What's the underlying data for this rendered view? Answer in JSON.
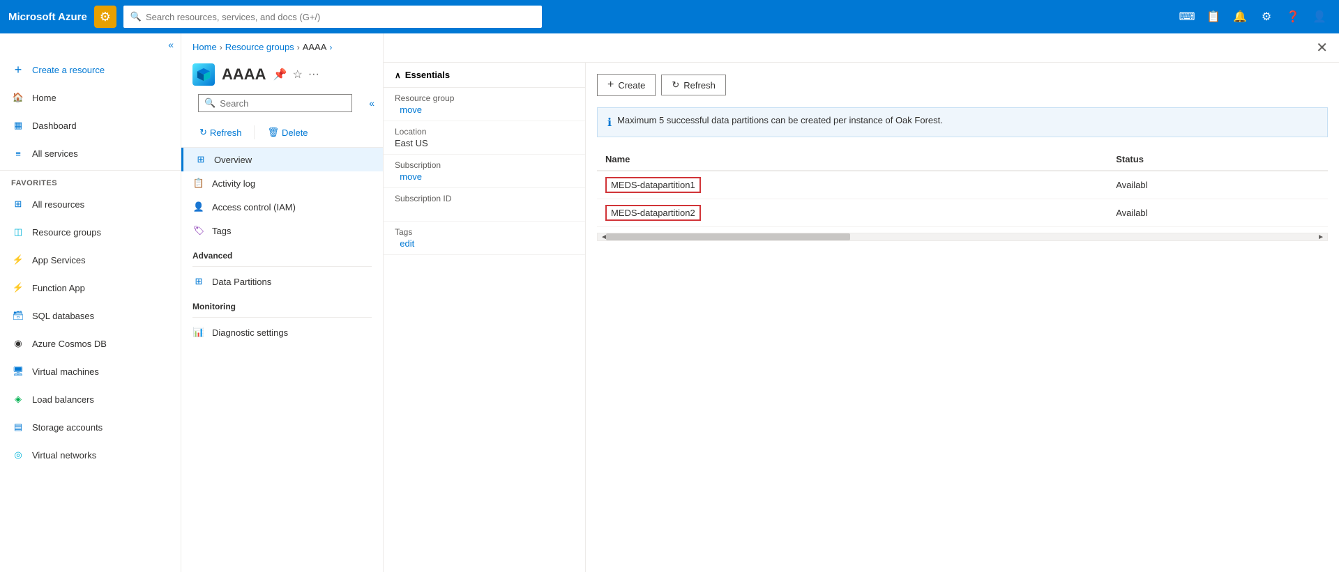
{
  "topbar": {
    "logo": "Microsoft Azure",
    "search_placeholder": "Search resources, services, and docs (G+/)",
    "shortcut": "G+/"
  },
  "sidebar": {
    "collapse_tooltip": "Collapse",
    "items": [
      {
        "id": "create-resource",
        "label": "Create a resource",
        "icon": "plus"
      },
      {
        "id": "home",
        "label": "Home",
        "icon": "home"
      },
      {
        "id": "dashboard",
        "label": "Dashboard",
        "icon": "dashboard"
      },
      {
        "id": "all-services",
        "label": "All services",
        "icon": "all-services"
      }
    ],
    "favorites_label": "FAVORITES",
    "favorites": [
      {
        "id": "all-resources",
        "label": "All resources",
        "icon": "grid"
      },
      {
        "id": "resource-groups",
        "label": "Resource groups",
        "icon": "resource-groups"
      },
      {
        "id": "app-services",
        "label": "App Services",
        "icon": "app-services"
      },
      {
        "id": "function-app",
        "label": "Function App",
        "icon": "function-app"
      },
      {
        "id": "sql-databases",
        "label": "SQL databases",
        "icon": "sql"
      },
      {
        "id": "azure-cosmos-db",
        "label": "Azure Cosmos DB",
        "icon": "cosmos"
      },
      {
        "id": "virtual-machines",
        "label": "Virtual machines",
        "icon": "vm"
      },
      {
        "id": "load-balancers",
        "label": "Load balancers",
        "icon": "lb"
      },
      {
        "id": "storage-accounts",
        "label": "Storage accounts",
        "icon": "storage"
      },
      {
        "id": "virtual-networks",
        "label": "Virtual networks",
        "icon": "vnet"
      }
    ]
  },
  "breadcrumb": {
    "home": "Home",
    "resource_groups": "Resource groups",
    "current": "AAAA"
  },
  "resource_group": {
    "name": "AAAA",
    "search_placeholder": "Search",
    "toolbar": {
      "refresh": "Refresh",
      "delete": "Delete"
    },
    "nav_items": [
      {
        "id": "overview",
        "label": "Overview",
        "active": true
      },
      {
        "id": "activity-log",
        "label": "Activity log"
      },
      {
        "id": "access-control",
        "label": "Access control (IAM)"
      },
      {
        "id": "tags",
        "label": "Tags"
      }
    ],
    "sections": {
      "advanced": {
        "label": "Advanced",
        "items": [
          {
            "id": "data-partitions",
            "label": "Data Partitions"
          }
        ]
      },
      "monitoring": {
        "label": "Monitoring",
        "items": [
          {
            "id": "diagnostic-settings",
            "label": "Diagnostic settings"
          }
        ]
      }
    }
  },
  "essentials": {
    "header": "Essentials",
    "fields": [
      {
        "label": "Resource group",
        "value": "",
        "link": "move",
        "has_link": true
      },
      {
        "label": "Location",
        "value": "East US",
        "has_link": false
      },
      {
        "label": "Subscription",
        "value": "",
        "link": "move",
        "has_link": true
      },
      {
        "label": "Subscription ID",
        "value": "",
        "has_link": false
      },
      {
        "label": "Tags",
        "value": "",
        "link": "edit",
        "has_link": true
      }
    ]
  },
  "right_panel": {
    "create_label": "Create",
    "refresh_label": "Refresh",
    "info_message": "Maximum 5 successful data partitions can be created per instance of Oak Forest.",
    "table": {
      "columns": [
        "Name",
        "Status"
      ],
      "rows": [
        {
          "name": "MEDS-datapartition1",
          "status": "Availabl"
        },
        {
          "name": "MEDS-datapartition2",
          "status": "Availabl"
        }
      ]
    }
  }
}
